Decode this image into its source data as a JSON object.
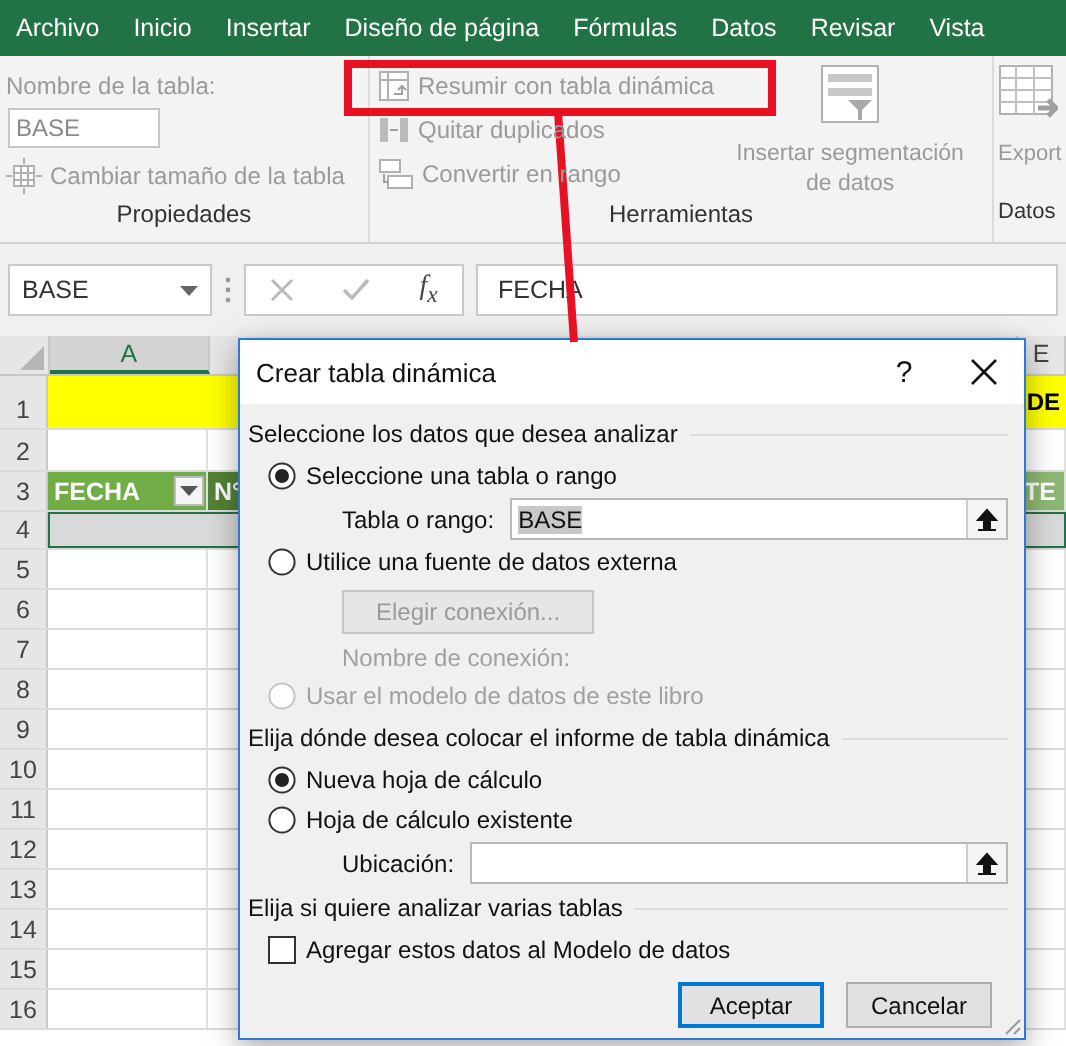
{
  "ribbon_tabs": [
    {
      "label": "Archivo"
    },
    {
      "label": "Inicio"
    },
    {
      "label": "Insertar"
    },
    {
      "label": "Diseño de página"
    },
    {
      "label": "Fórmulas"
    },
    {
      "label": "Datos"
    },
    {
      "label": "Revisar"
    },
    {
      "label": "Vista"
    }
  ],
  "ribbon": {
    "groups": [
      {
        "kind": "properties",
        "label": "Propiedades",
        "name_label": "Nombre de la tabla:",
        "name_value": "BASE",
        "commands": [
          {
            "label": "Cambiar tamaño de la tabla",
            "disabled": true
          }
        ]
      },
      {
        "kind": "tools",
        "label": "Herramientas",
        "commands": [
          {
            "label": "Resumir con tabla dinámica",
            "disabled": true
          },
          {
            "label": "Quitar duplicados",
            "disabled": true
          },
          {
            "label": "Convertir en rango",
            "disabled": true
          }
        ],
        "large_command": {
          "label": "Insertar segmentación de datos",
          "disabled": true
        }
      },
      {
        "kind": "export",
        "label": "Datos",
        "large_command": {
          "label": "Export",
          "disabled": true
        }
      }
    ]
  },
  "formula_bar": {
    "name_box": "BASE",
    "insert_function": "f$_{x}$",
    "formula": "FECHA"
  },
  "sheet": {
    "columns": [
      {
        "label": "A"
      },
      {
        "label": "E"
      }
    ],
    "rows": [
      {
        "number": "1",
        "kind": "title",
        "edge_text": "DE"
      },
      {
        "number": "2",
        "kind": "blank"
      },
      {
        "number": "3",
        "kind": "header",
        "column_a": "FECHA",
        "column_b": "N°",
        "edge_text": "TE"
      },
      {
        "number": "4",
        "kind": "selected"
      },
      {
        "number": "5",
        "kind": "blank"
      },
      {
        "number": "6",
        "kind": "blank"
      },
      {
        "number": "7",
        "kind": "blank"
      },
      {
        "number": "8",
        "kind": "blank"
      },
      {
        "number": "9",
        "kind": "blank"
      },
      {
        "number": "10",
        "kind": "blank"
      },
      {
        "number": "11",
        "kind": "blank"
      },
      {
        "number": "12",
        "kind": "blank"
      },
      {
        "number": "13",
        "kind": "blank"
      },
      {
        "number": "14",
        "kind": "blank"
      },
      {
        "number": "15",
        "kind": "blank"
      },
      {
        "number": "16",
        "kind": "blank"
      }
    ]
  },
  "dialog": {
    "title": "Crear tabla dinámica",
    "help": "?",
    "sections": [
      {
        "heading": "Seleccione los datos que desea analizar",
        "items": [
          {
            "kind": "radio",
            "label": "Seleccione una tabla o rango",
            "selected": true,
            "disabled": false
          },
          {
            "kind": "field",
            "label": "Tabla o rango:",
            "value": "BASE",
            "disabled": false
          },
          {
            "kind": "radio",
            "label": "Utilice una fuente de datos externa",
            "selected": false,
            "disabled": false
          },
          {
            "kind": "button",
            "label": "Elegir conexión...",
            "disabled": true
          },
          {
            "kind": "caption",
            "label": "Nombre de conexión:",
            "disabled": true
          },
          {
            "kind": "radio",
            "label": "Usar el modelo de datos de este libro",
            "selected": false,
            "disabled": true
          }
        ]
      },
      {
        "heading": "Elija dónde desea colocar el informe de tabla dinámica",
        "items": [
          {
            "kind": "radio",
            "label": "Nueva hoja de cálculo",
            "selected": true,
            "disabled": false
          },
          {
            "kind": "radio",
            "label": "Hoja de cálculo existente",
            "selected": false,
            "disabled": false
          },
          {
            "kind": "field",
            "label": "Ubicación:",
            "disabled": false
          }
        ]
      },
      {
        "heading": "Elija si quiere analizar varias tablas",
        "items": [
          {
            "kind": "checkbox",
            "label": "Agregar estos datos al Modelo de datos",
            "checked": false,
            "disabled": false
          }
        ]
      }
    ],
    "buttons": [
      {
        "label": "Aceptar",
        "default": true
      },
      {
        "label": "Cancelar",
        "default": false
      }
    ]
  }
}
